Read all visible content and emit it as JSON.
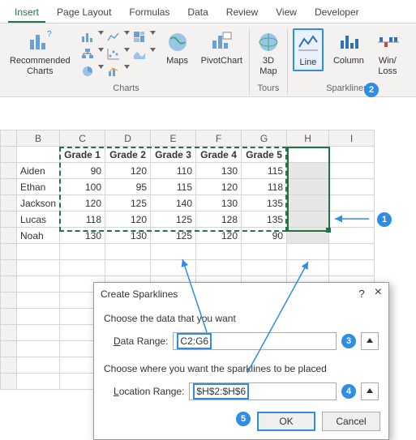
{
  "ribbon": {
    "tabs": [
      "Insert",
      "Page Layout",
      "Formulas",
      "Data",
      "Review",
      "View",
      "Developer"
    ],
    "active_tab": "Insert",
    "groups": {
      "charts": {
        "label": "Charts",
        "recommended": "Recommended\nCharts",
        "maps": "Maps",
        "pivot": "PivotChart"
      },
      "tours": {
        "label": "Tours",
        "map3d": "3D\nMap"
      },
      "sparklines": {
        "label": "Sparklines",
        "line": "Line",
        "column": "Column",
        "winloss": "Win/\nLoss"
      }
    }
  },
  "sheet": {
    "columns": [
      "",
      "B",
      "C",
      "D",
      "E",
      "F",
      "G",
      "H",
      "I"
    ],
    "headers": [
      "Grade 1",
      "Grade 2",
      "Grade 3",
      "Grade 4",
      "Grade 5"
    ],
    "rows": [
      {
        "name": "Aiden",
        "v": [
          90,
          120,
          110,
          130,
          115
        ]
      },
      {
        "name": "Ethan",
        "v": [
          100,
          95,
          115,
          120,
          118
        ]
      },
      {
        "name": "Jackson",
        "v": [
          120,
          125,
          140,
          130,
          135
        ]
      },
      {
        "name": "Lucas",
        "v": [
          118,
          120,
          125,
          128,
          135
        ]
      },
      {
        "name": "Noah",
        "v": [
          130,
          130,
          125,
          120,
          90
        ]
      }
    ]
  },
  "dialog": {
    "title": "Create Sparklines",
    "help": "?",
    "close": "×",
    "section1": "Choose the data that you want",
    "data_label": "Data Range:",
    "data_value": "C2:G6",
    "section2": "Choose where you want the sparklines to be placed",
    "loc_label": "Location Range:",
    "loc_value": "$H$2:$H$6",
    "ok": "OK",
    "cancel": "Cancel"
  },
  "annotations": {
    "n1": "1",
    "n2": "2",
    "n3": "3",
    "n4": "4",
    "n5": "5"
  }
}
